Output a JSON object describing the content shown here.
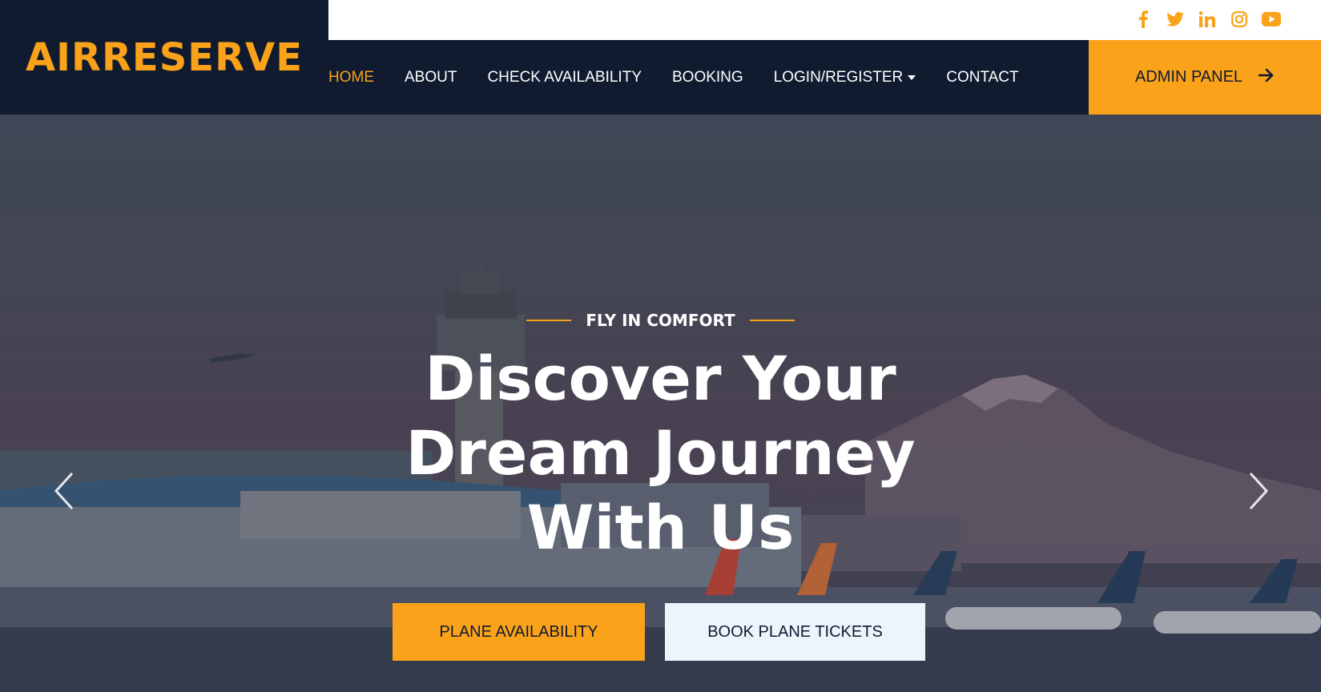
{
  "brand": {
    "name": "AIRRESERVE"
  },
  "social": [
    "facebook-icon",
    "twitter-icon",
    "linkedin-icon",
    "instagram-icon",
    "youtube-icon"
  ],
  "nav": {
    "items": [
      {
        "label": "HOME",
        "active": true
      },
      {
        "label": "ABOUT"
      },
      {
        "label": "CHECK AVAILABILITY"
      },
      {
        "label": "BOOKING"
      },
      {
        "label": "LOGIN/REGISTER",
        "dropdown": true
      },
      {
        "label": "CONTACT"
      }
    ],
    "admin_label": "ADMIN PANEL"
  },
  "hero": {
    "tagline": "FLY IN COMFORT",
    "headline_lines": [
      "Discover Your",
      "Dream Journey",
      "With Us"
    ],
    "primary_button": "PLANE AVAILABILITY",
    "secondary_button": "BOOK PLANE TICKETS"
  },
  "colors": {
    "accent": "#f9a21a",
    "navy": "#111b30",
    "light_button": "#eef4fb"
  }
}
